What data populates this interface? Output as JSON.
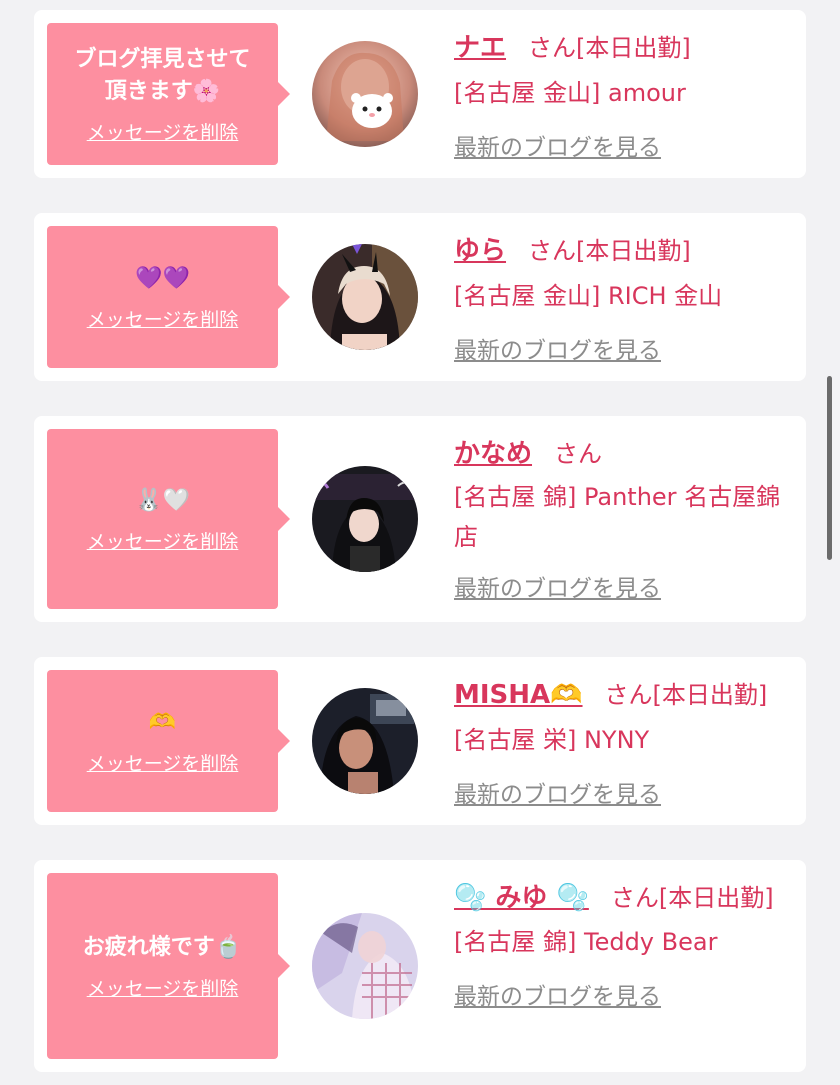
{
  "cards": [
    {
      "message_lines": [
        "ブログ拝見させて",
        "頂きます🌸"
      ],
      "delete_label": "メッセージを削除",
      "name": "ナエ",
      "san_suffix": "さん[本日出勤]",
      "location": "[名古屋 金山] amour",
      "blog_link": "最新のブログを見る"
    },
    {
      "message_lines": [
        "💜💜"
      ],
      "delete_label": "メッセージを削除",
      "name": "ゆら",
      "san_suffix": "さん[本日出勤]",
      "location": "[名古屋 金山] RICH 金山",
      "blog_link": "最新のブログを見る"
    },
    {
      "message_lines": [
        "🐰🤍"
      ],
      "delete_label": "メッセージを削除",
      "name": "かなめ",
      "san_suffix": "さん",
      "location": "[名古屋 錦] Panther 名古屋錦店",
      "blog_link": "最新のブログを見る"
    },
    {
      "message_lines": [
        "🫶"
      ],
      "delete_label": "メッセージを削除",
      "name": "MISHA🫶",
      "san_suffix": "さん[本日出勤]",
      "location": "[名古屋 栄] NYNY",
      "blog_link": "最新のブログを見る"
    },
    {
      "message_lines": [
        "お疲れ様です🍵"
      ],
      "delete_label": "メッセージを削除",
      "name": "🫧 みゆ 🫧",
      "san_suffix": "さん[本日出勤]",
      "location": "[名古屋 錦] Teddy Bear",
      "blog_link": "最新のブログを見る"
    }
  ],
  "colors": {
    "bubble": "#fd8fa0",
    "accent_text": "#d8365c",
    "link_gray": "#8c8c8c",
    "background": "#f2f2f4"
  }
}
